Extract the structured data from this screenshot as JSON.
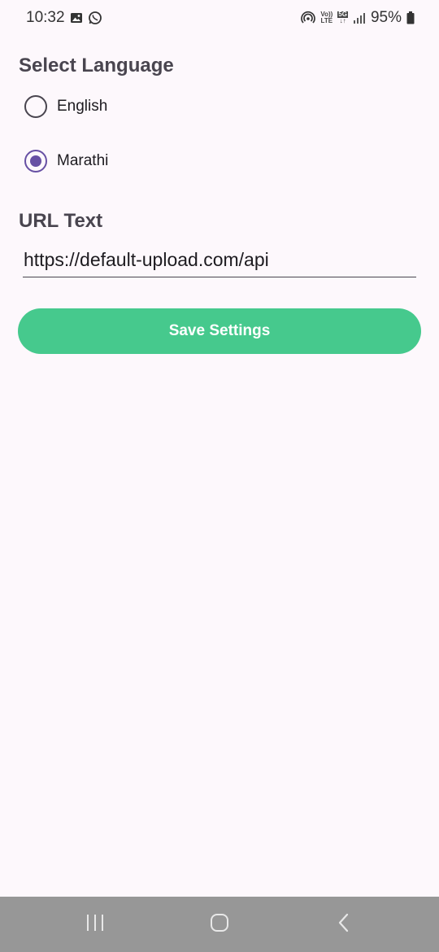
{
  "status_bar": {
    "time": "10:32",
    "battery": "95%",
    "icons": [
      "image-icon",
      "whatsapp-icon",
      "hotspot-icon",
      "volte-icon",
      "5g-icon",
      "signal-icon",
      "battery-icon"
    ],
    "volte_top": "Vo))",
    "volte_bottom": "LTE",
    "fiveg": "5G"
  },
  "language": {
    "title": "Select Language",
    "options": [
      {
        "label": "English",
        "selected": false
      },
      {
        "label": "Marathi",
        "selected": true
      }
    ]
  },
  "url": {
    "title": "URL Text",
    "value": "https://default-upload.com/api"
  },
  "actions": {
    "save_label": "Save Settings"
  },
  "nav": {
    "buttons": [
      "recents-icon",
      "home-icon",
      "back-icon"
    ]
  },
  "colors": {
    "background": "#fdf8fc",
    "accent": "#6750a4",
    "button": "#46c98d",
    "nav_bar": "#979797"
  }
}
